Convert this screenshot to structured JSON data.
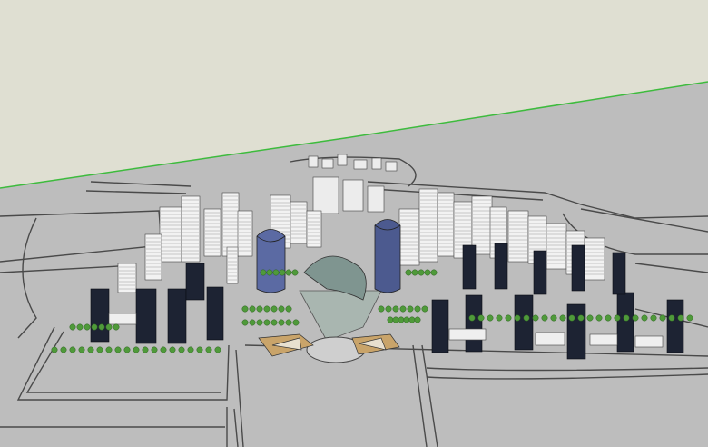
{
  "scene": {
    "subject": "3d-urban-masterplan-model",
    "colors": {
      "sky": "#dfdfd2",
      "ground": "#bebebe",
      "horizon_line": "#3dbb3d",
      "road_line": "#4a4a4a",
      "tower_dark": "#1d2333",
      "tower_blue": "#5b6aa3",
      "tower_white": "#f2f2f2",
      "tree": "#4f9a3a",
      "plaza": "#a9b6b0",
      "accent_brown": "#8c6a45"
    },
    "icons": [
      "tree-icon"
    ]
  }
}
